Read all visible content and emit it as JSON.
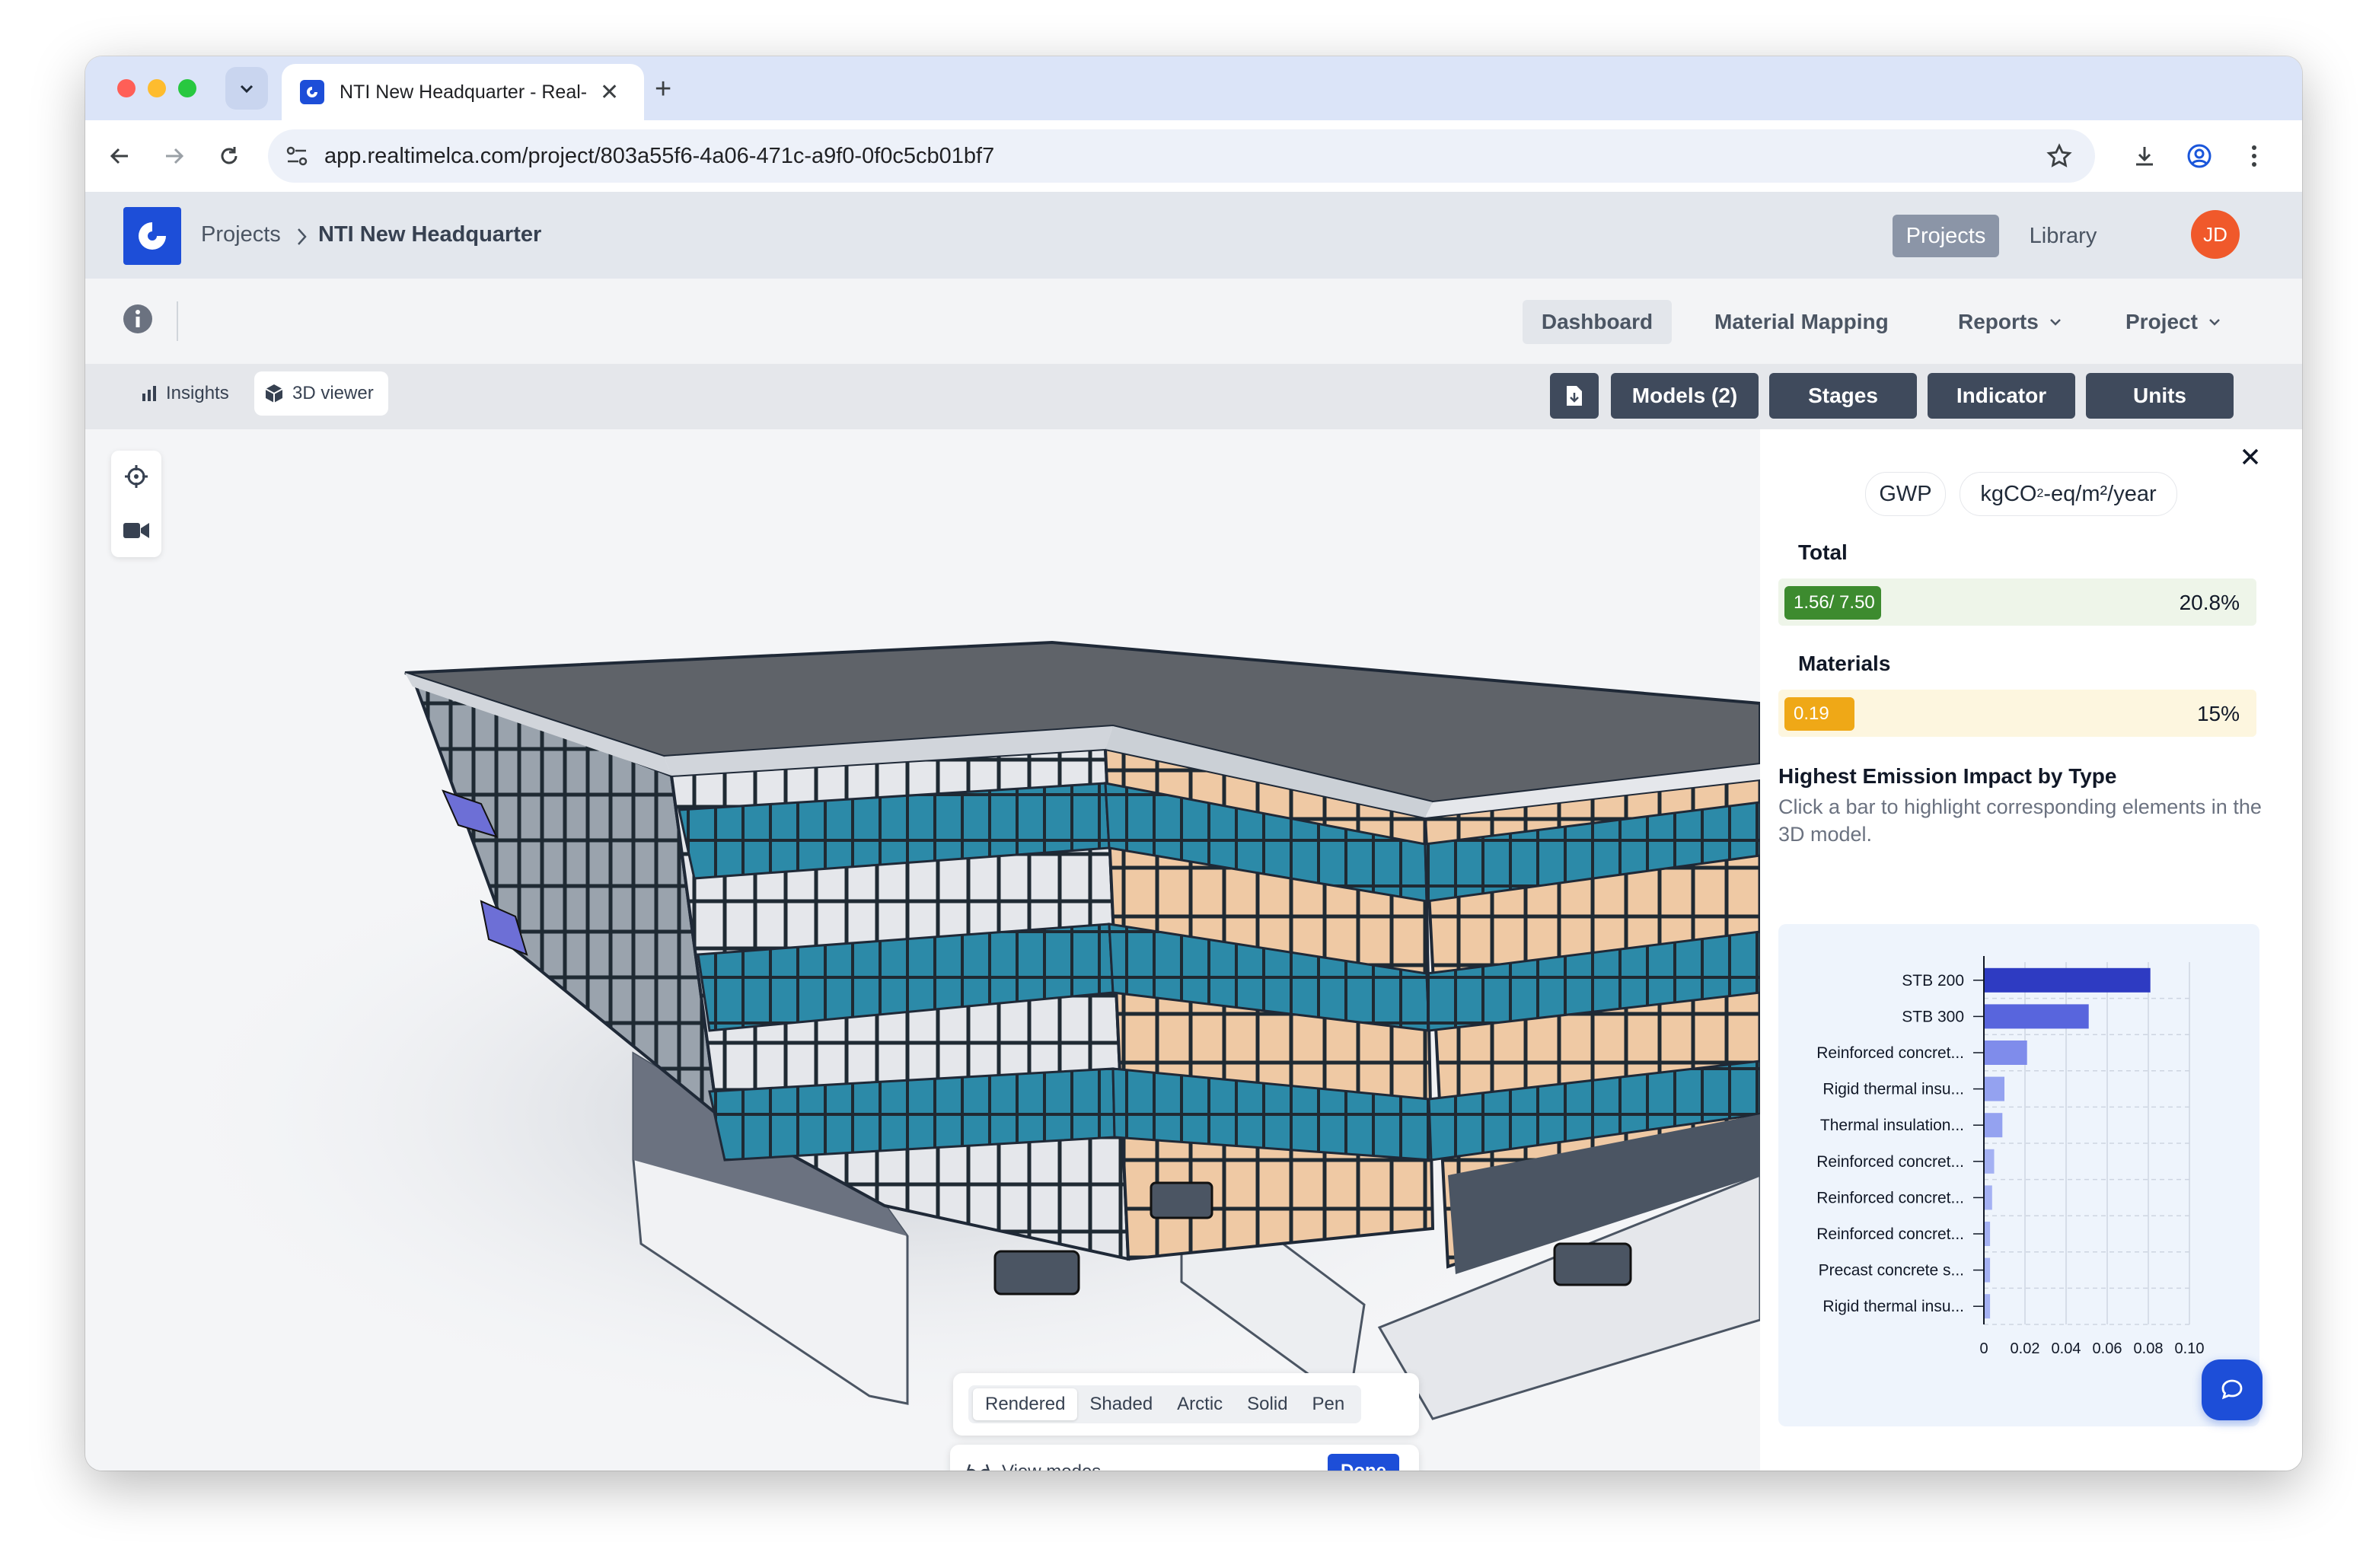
{
  "browser": {
    "tab_title": "NTI New Headquarter - Real-",
    "url": "app.realtimelca.com/project/803a55f6-4a06-471c-a9f0-0f0c5cb01bf7"
  },
  "header": {
    "breadcrumb_root": "Projects",
    "breadcrumb_current": "NTI New Headquarter",
    "projects_link": "Projects",
    "library_link": "Library",
    "avatar_initials": "JD"
  },
  "subnav": {
    "dashboard": "Dashboard",
    "material_mapping": "Material Mapping",
    "reports": "Reports",
    "project": "Project"
  },
  "toolrow": {
    "insights_tab": "Insights",
    "viewer_tab": "3D viewer",
    "models_btn": "Models (2)",
    "stages_btn": "Stages",
    "indicator_btn": "Indicator",
    "units_btn": "Units"
  },
  "view_modes": {
    "options": [
      "Rendered",
      "Shaded",
      "Arctic",
      "Solid",
      "Pen"
    ],
    "selected": "Rendered",
    "label": "View modes",
    "done": "Done"
  },
  "panel": {
    "indicator_chip": "GWP",
    "unit_chip_pre": "kgCO",
    "unit_chip_sub": "2",
    "unit_chip_post": "-eq/m²/year",
    "total_label": "Total",
    "total_value": "1.56/ 7.50",
    "total_fraction": 0.208,
    "total_pct": "20.8%",
    "materials_label": "Materials",
    "materials_value": "0.19",
    "materials_fraction": 0.15,
    "materials_pct": "15%",
    "chart_title": "Highest Emission Impact by Type",
    "chart_hint": "Click a bar to highlight corresponding elements in the 3D model."
  },
  "chart_data": {
    "type": "bar",
    "orientation": "horizontal",
    "categories": [
      "STB 200",
      "STB 300",
      "Reinforced concret...",
      "Rigid thermal insu...",
      "Thermal insulation...",
      "Reinforced concret...",
      "Reinforced concret...",
      "Reinforced concret...",
      "Precast concrete s...",
      "Rigid thermal insu..."
    ],
    "values": [
      0.081,
      0.051,
      0.021,
      0.01,
      0.009,
      0.005,
      0.004,
      0.003,
      0.003,
      0.003
    ],
    "colors": [
      "#2e3bc2",
      "#5865dd",
      "#7f8ceb",
      "#94a2f0",
      "#94a2f0",
      "#a4b1f3",
      "#a4b1f3",
      "#a4b1f3",
      "#a4b1f3",
      "#a4b1f3"
    ],
    "xlim": [
      0,
      0.1
    ],
    "xticks": [
      "0",
      "0.02",
      "0.04",
      "0.06",
      "0.08",
      "0.10"
    ],
    "grid": true
  },
  "colors": {
    "accent": "#1d4ed8",
    "dark_button": "#3f4a5c",
    "total_bar": "#3d8b2f",
    "materials_bar": "#efa817",
    "avatar": "#f0592b"
  }
}
